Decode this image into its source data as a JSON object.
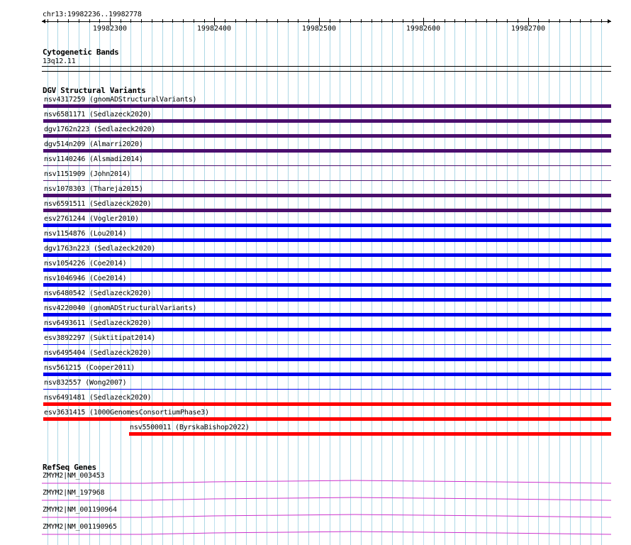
{
  "location": "chr13:19982236..19982778",
  "ruler": {
    "ticks": [
      "19982300",
      "19982400",
      "19982500",
      "19982600",
      "19982700"
    ]
  },
  "cytoband": {
    "title": "Cytogenetic Bands",
    "band": "13q12.11"
  },
  "dgv": {
    "title": "DGV Structural Variants",
    "colors": {
      "purple": "#4b0f6e",
      "blue": "#0000ee",
      "red": "#ff0000"
    },
    "variants": [
      {
        "label": "nsv4317259 (gnomADStructuralVariants)",
        "color": "purple",
        "style": "thick",
        "start": 19982236
      },
      {
        "label": "nsv6581171 (Sedlazeck2020)",
        "color": "purple",
        "style": "thick",
        "start": 19982236
      },
      {
        "label": "dgv1762n223 (Sedlazeck2020)",
        "color": "purple",
        "style": "thick",
        "start": 19982236
      },
      {
        "label": "dgv514n209 (Almarri2020)",
        "color": "purple",
        "style": "thick",
        "start": 19982236
      },
      {
        "label": "nsv1140246 (Alsmadi2014)",
        "color": "purple",
        "style": "thin",
        "start": 19982236
      },
      {
        "label": "nsv1151909 (John2014)",
        "color": "purple",
        "style": "thin",
        "start": 19982236
      },
      {
        "label": "nsv1078303 (Thareja2015)",
        "color": "purple",
        "style": "thick",
        "start": 19982236
      },
      {
        "label": "nsv6591511 (Sedlazeck2020)",
        "color": "purple",
        "style": "thick",
        "start": 19982236
      },
      {
        "label": "esv2761244 (Vogler2010)",
        "color": "blue",
        "style": "thick",
        "start": 19982236
      },
      {
        "label": "nsv1154876 (Lou2014)",
        "color": "blue",
        "style": "thick",
        "start": 19982236
      },
      {
        "label": "dgv1763n223 (Sedlazeck2020)",
        "color": "blue",
        "style": "thick",
        "start": 19982236
      },
      {
        "label": "nsv1054226 (Coe2014)",
        "color": "blue",
        "style": "thick",
        "start": 19982236
      },
      {
        "label": "nsv1046946 (Coe2014)",
        "color": "blue",
        "style": "thick",
        "start": 19982236
      },
      {
        "label": "nsv6480542 (Sedlazeck2020)",
        "color": "blue",
        "style": "thick",
        "start": 19982236
      },
      {
        "label": "nsv4220040 (gnomADStructuralVariants)",
        "color": "blue",
        "style": "thick",
        "start": 19982236
      },
      {
        "label": "nsv6493611 (Sedlazeck2020)",
        "color": "blue",
        "style": "thick",
        "start": 19982236
      },
      {
        "label": "esv3892297 (Suktitipat2014)",
        "color": "blue",
        "style": "thin",
        "start": 19982236
      },
      {
        "label": "nsv6495404 (Sedlazeck2020)",
        "color": "blue",
        "style": "thick",
        "start": 19982236
      },
      {
        "label": "nsv561215 (Cooper2011)",
        "color": "blue",
        "style": "thick",
        "start": 19982236
      },
      {
        "label": "nsv832557 (Wong2007)",
        "color": "blue",
        "style": "thin",
        "start": 19982236
      },
      {
        "label": "nsv6491481 (Sedlazeck2020)",
        "color": "red",
        "style": "thick",
        "start": 19982236
      },
      {
        "label": "esv3631415 (1000GenomesConsortiumPhase3)",
        "color": "red",
        "style": "thick",
        "start": 19982236
      },
      {
        "label": "nsv5500011 (ByrskaBishop2022)",
        "color": "red",
        "style": "thick",
        "start": 19982318
      }
    ]
  },
  "refseq": {
    "title": "RefSeq Genes",
    "color": "#cc33cc",
    "genes": [
      {
        "label": "ZMYM2|NM_003453"
      },
      {
        "label": "ZMYM2|NM_197968"
      },
      {
        "label": "ZMYM2|NM_001190964"
      },
      {
        "label": "ZMYM2|NM_001190965"
      }
    ]
  }
}
